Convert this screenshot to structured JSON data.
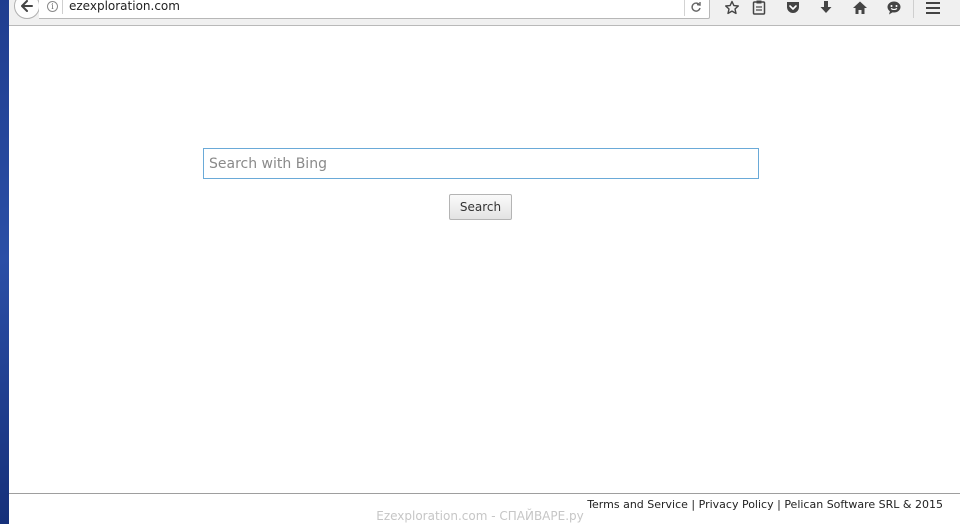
{
  "browser": {
    "url": "ezexploration.com",
    "icons": [
      "back-arrow-icon",
      "info-icon",
      "reload-icon",
      "bookmark-star-icon",
      "reading-list-icon",
      "pocket-icon",
      "download-icon",
      "home-icon",
      "chat-icon",
      "hamburger-menu-icon"
    ]
  },
  "search": {
    "placeholder": "Search with Bing",
    "value": "",
    "button_label": "Search"
  },
  "footer": {
    "terms": "Terms and Service",
    "separator1": " | ",
    "privacy": "Privacy Policy",
    "separator2": " | ",
    "copyright": "Pelican Software SRL & 2015"
  },
  "watermark": "Ezexploration.com - СПАЙВАРЕ.ру",
  "colors": {
    "input_border": "#6aaad8",
    "desktop": "#1f3d8f"
  }
}
